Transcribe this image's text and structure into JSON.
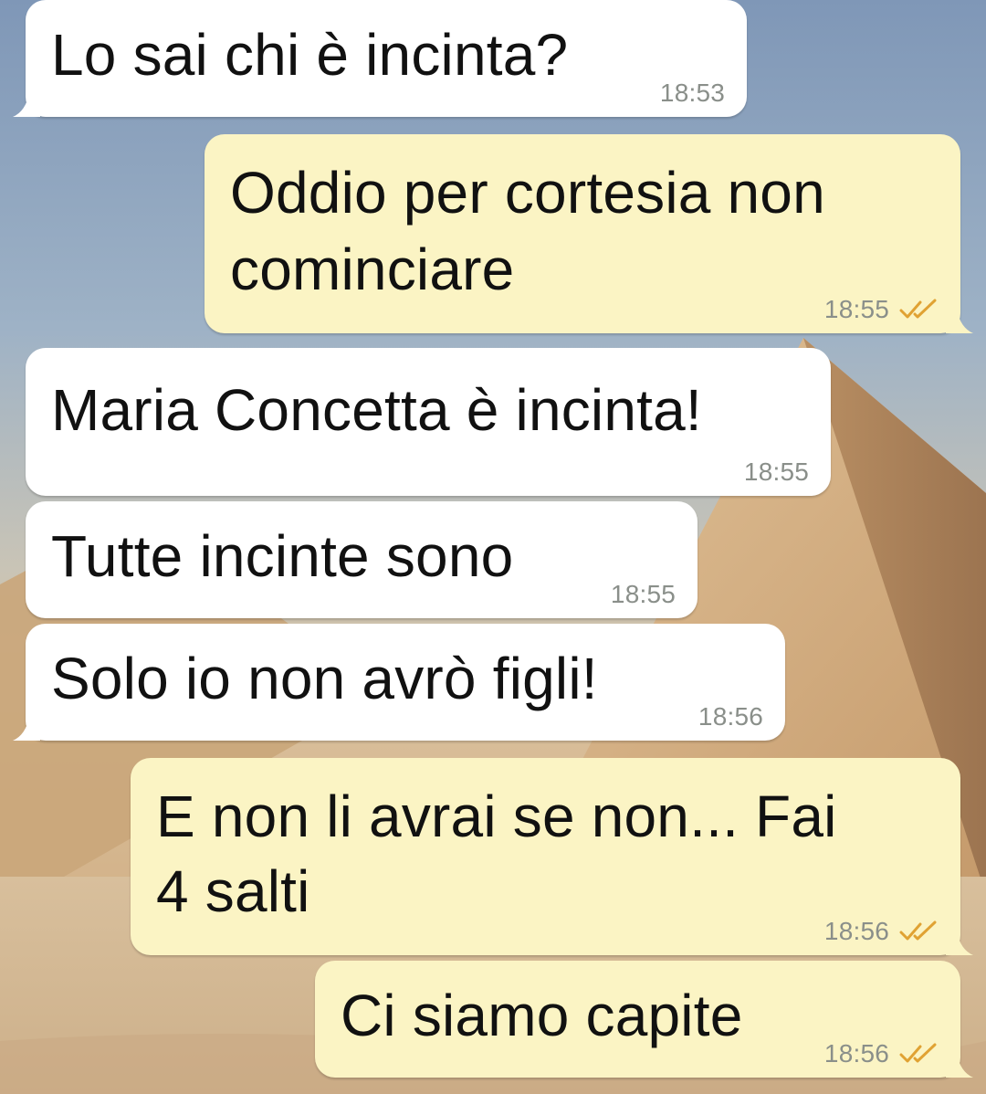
{
  "chat": {
    "messages": [
      {
        "direction": "incoming",
        "text": "Lo sai chi è incinta?",
        "time": "18:53"
      },
      {
        "direction": "outgoing",
        "lines": [
          "Oddio per cortesia non",
          "cominciare"
        ],
        "time": "18:55",
        "status": "read"
      },
      {
        "direction": "incoming",
        "text": "Maria Concetta è incinta!",
        "time": "18:55"
      },
      {
        "direction": "incoming",
        "text": "Tutte incinte sono",
        "time": "18:55"
      },
      {
        "direction": "incoming",
        "text": "Solo io non avrò figli!",
        "time": "18:56"
      },
      {
        "direction": "outgoing",
        "lines": [
          "E non li avrai se non... Fai",
          "4 salti"
        ],
        "time": "18:56",
        "status": "read"
      },
      {
        "direction": "outgoing",
        "text": "Ci siamo capite",
        "time": "18:56",
        "status": "read"
      }
    ]
  },
  "icons": {
    "read_receipt": "double-check-icon"
  },
  "colors": {
    "incoming_bubble": "#ffffff",
    "outgoing_bubble": "#fbf4c4",
    "timestamp": "#8a8f8a",
    "read_ticks": "#e0a233"
  }
}
